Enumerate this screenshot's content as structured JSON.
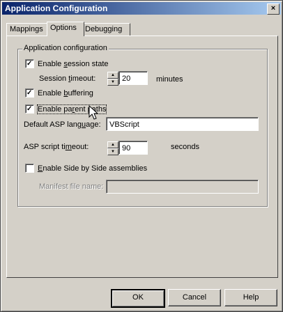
{
  "window": {
    "title": "Application Configuration",
    "close_glyph": "×"
  },
  "tabs": [
    {
      "label": "Mappings"
    },
    {
      "label": "Options"
    },
    {
      "label": "Debugging"
    }
  ],
  "group": {
    "label": "Application configuration"
  },
  "session_state": {
    "label_pre": "Enable ",
    "label_u": "s",
    "label_post": "ession state",
    "checked": true
  },
  "session_timeout": {
    "label_pre": "Session ",
    "label_u": "t",
    "label_post": "imeout:",
    "value": "20",
    "unit": "minutes"
  },
  "buffering": {
    "label_pre": "Enable ",
    "label_u": "b",
    "label_post": "uffering",
    "checked": true
  },
  "parent_paths": {
    "label_pre": "Enable pa",
    "label_u": "r",
    "label_post": "ent paths",
    "checked": true
  },
  "default_language": {
    "label_pre": "Default ASP lang",
    "label_u": "u",
    "label_post": "age:",
    "value": "VBScript"
  },
  "script_timeout": {
    "label_pre": "ASP script ti",
    "label_u": "m",
    "label_post": "eout:",
    "value": "90",
    "unit": "seconds"
  },
  "side_by_side": {
    "label_pre": "",
    "label_u": "E",
    "label_post": "nable Side by Side assemblies",
    "checked": false
  },
  "manifest": {
    "label_pre": "Manifest file name:",
    "value": ""
  },
  "buttons": {
    "ok": "OK",
    "cancel": "Cancel",
    "help": "Help"
  }
}
